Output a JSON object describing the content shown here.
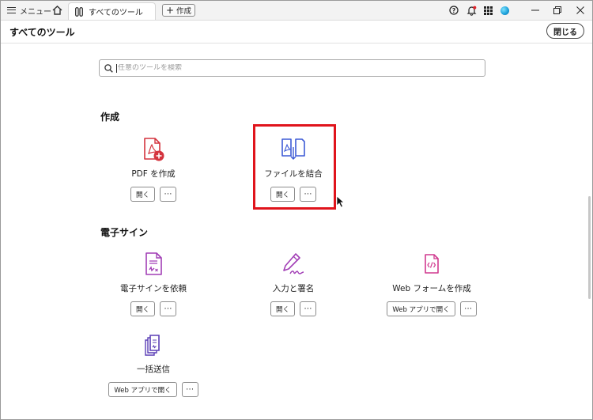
{
  "titlebar": {
    "menu_label": "メニュー",
    "tab_label": "すべてのツール",
    "new_label": "作成"
  },
  "header": {
    "title": "すべてのツール",
    "close_label": "閉じる"
  },
  "search": {
    "placeholder": "任意のツールを検索"
  },
  "sections": {
    "create": {
      "title": "作成",
      "tools": [
        {
          "label": "PDF を作成",
          "open": "開く",
          "more": "⋯"
        },
        {
          "label": "ファイルを結合",
          "open": "開く",
          "more": "⋯"
        }
      ]
    },
    "esign": {
      "title": "電子サイン",
      "tools": [
        {
          "label": "電子サインを依頼",
          "open": "開く",
          "more": "⋯"
        },
        {
          "label": "入力と署名",
          "open": "開く",
          "more": "⋯"
        },
        {
          "label": "Web フォームを作成",
          "open": "Web アプリで開く",
          "more": "⋯"
        },
        {
          "label": "一括送信",
          "open": "Web アプリで開く",
          "more": "⋯"
        }
      ]
    }
  },
  "colors": {
    "pdf_red": "#d4343e",
    "combine_blue": "#3e5bd6",
    "esign_purple": "#a23fb6",
    "highlight": "#e0141c"
  }
}
